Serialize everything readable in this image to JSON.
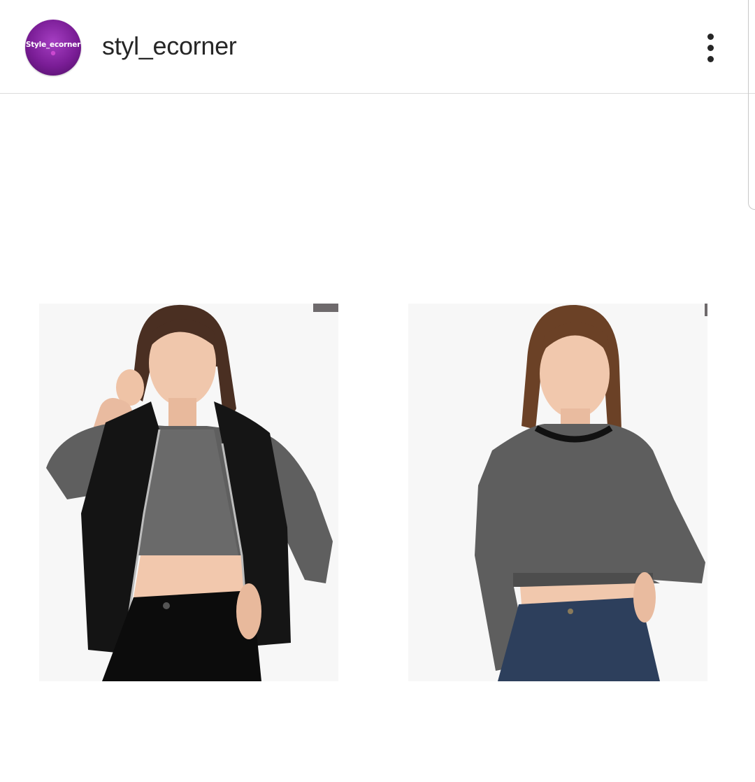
{
  "header": {
    "avatar_text": "Style_ecorner",
    "username": "styl_ecorner"
  },
  "icons": {
    "more": "more-vertical-icon"
  },
  "colors": {
    "avatar_purple": "#7a1d96",
    "text": "#262626",
    "divider": "#dbdbdb"
  },
  "post": {
    "images": [
      {
        "name": "model-black-puffer-vest-houndstooth-crop-top"
      },
      {
        "name": "model-grey-cropped-sweatshirt-jeans"
      }
    ]
  }
}
